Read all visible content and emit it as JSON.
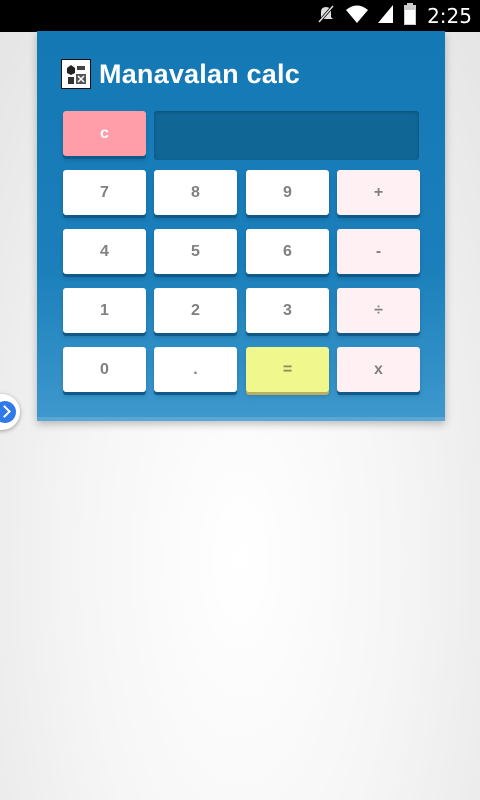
{
  "status_bar": {
    "time": "2:25",
    "icons": [
      "mute-icon",
      "wifi-icon",
      "signal-icon",
      "battery-icon"
    ]
  },
  "app": {
    "title": "Manavalan calc",
    "icon": "app-logo-icon"
  },
  "display": {
    "value": ""
  },
  "keys": {
    "clear": "c",
    "seven": "7",
    "eight": "8",
    "nine": "9",
    "plus": "+",
    "four": "4",
    "five": "5",
    "six": "6",
    "minus": "-",
    "one": "1",
    "two": "2",
    "three": "3",
    "divide": "÷",
    "zero": "0",
    "dot": ".",
    "equals": "=",
    "multiply": "x"
  },
  "colors": {
    "panel": "#1478b4",
    "display": "#106796",
    "clear_key": "#ff9ea8",
    "operator_key": "#fff0f3",
    "equals_key": "#f0f78c",
    "number_key": "#ffffff",
    "side_handle": "#2f79e8"
  }
}
